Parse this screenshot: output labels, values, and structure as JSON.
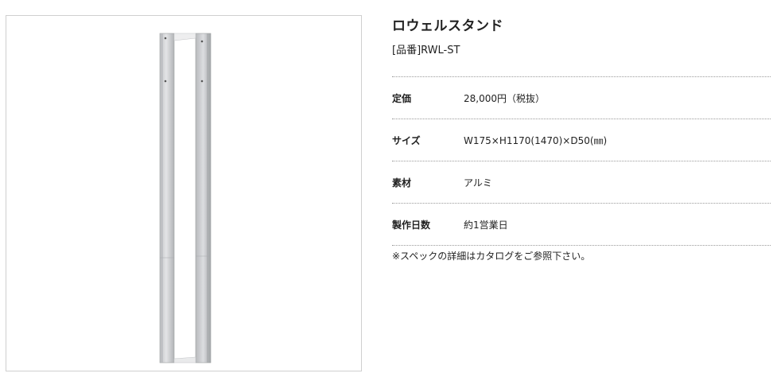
{
  "product": {
    "name": "ロウェルスタンド",
    "code": "[品番]RWL-ST",
    "image_alt": "ロウェルスタンド product image"
  },
  "specs": [
    {
      "label": "定価",
      "value": "28,000円（税抜）"
    },
    {
      "label": "サイズ",
      "value": "W175×H1170(1470)×D50(㎜)"
    },
    {
      "label": "素材",
      "value": "アルミ"
    },
    {
      "label": "製作日数",
      "value": "約1営業日"
    }
  ],
  "note": "※スペックの詳細はカタログをご参照下さい。",
  "colors": {
    "text": "#222222",
    "border": "#cfcfcf",
    "divider": "#9a9a9a",
    "aluminum_light": "#dfe0e2",
    "aluminum_dark": "#a9abae"
  }
}
